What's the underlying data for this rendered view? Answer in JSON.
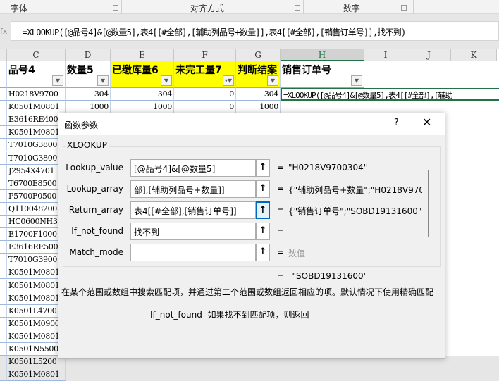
{
  "ribbon": {
    "groups": [
      "字体",
      "对齐方式",
      "数字"
    ]
  },
  "formula_bar": {
    "fx": "fx",
    "formula": "=XLOOKUP([@品号4]&[@数量5],表4[[#全部],[辅助列品号+数量]],表4[[#全部],[销售订单号]],找不到)"
  },
  "columns": [
    "C",
    "D",
    "E",
    "F",
    "G",
    "H",
    "I",
    "J",
    "K"
  ],
  "headers": [
    "品号4",
    "数量5",
    "已缴库量6",
    "未完工量7",
    "判断结案",
    "销售订单号"
  ],
  "rows": [
    {
      "c": "H0218V9700",
      "d": "304",
      "e": "304",
      "f": "0",
      "g": "304",
      "h": "=XLOOKUP([@品号4]&[@数量5],表4[[#全部],[辅助"
    },
    {
      "c": "K0501M0801",
      "d": "1000",
      "e": "1000",
      "f": "0",
      "g": "1000",
      "h": ""
    },
    {
      "c": "E3616RE400"
    },
    {
      "c": "K0501M0801"
    },
    {
      "c": "T7010G3800"
    },
    {
      "c": "T7010G3800"
    },
    {
      "c": "J2954X4701"
    },
    {
      "c": "T6700E8500"
    },
    {
      "c": "P5700F0500"
    },
    {
      "c": "Q110048200"
    },
    {
      "c": "HC0600NH30"
    },
    {
      "c": "E1700F1000"
    },
    {
      "c": "E3616RE500"
    },
    {
      "c": "T7010G3900"
    },
    {
      "c": "K0501M0801"
    },
    {
      "c": "K0501M0801"
    },
    {
      "c": "K0501M0801"
    },
    {
      "c": "K0501L4700"
    },
    {
      "c": "K0501M0900"
    },
    {
      "c": "K0501M0801"
    },
    {
      "c": "K0501N5500"
    },
    {
      "c": "K0501L5200"
    },
    {
      "c": "K0501M0801"
    }
  ],
  "dialog": {
    "title": "函数参数",
    "help": "?",
    "close": "✕",
    "function_name": "XLOOKUP",
    "args": [
      {
        "label": "Lookup_value",
        "input": "[@品号4]&[@数量5]",
        "value": "\"H0218V9700304\""
      },
      {
        "label": "Lookup_array",
        "input": "部],[辅助列品号+数量]]",
        "value": "{\"辅助列品号+数量\";\"H0218V970"
      },
      {
        "label": "Return_array",
        "input": "表4[[#全部],[销售订单号]]",
        "value": "{\"销售订单号\";\"SOBD19131600\";"
      },
      {
        "label": "If_not_found",
        "input": "找不到",
        "value": ""
      },
      {
        "label": "Match_mode",
        "input": "",
        "value": "数值"
      }
    ],
    "equals": "=",
    "result": "\"SOBD19131600\"",
    "description": "在某个范围或数组中搜索匹配项，并通过第二个范围或数组返回相应的项。默认情况下使用精确匹配",
    "param_name": "If_not_found",
    "param_desc": "如果找不到匹配项，则返回"
  }
}
